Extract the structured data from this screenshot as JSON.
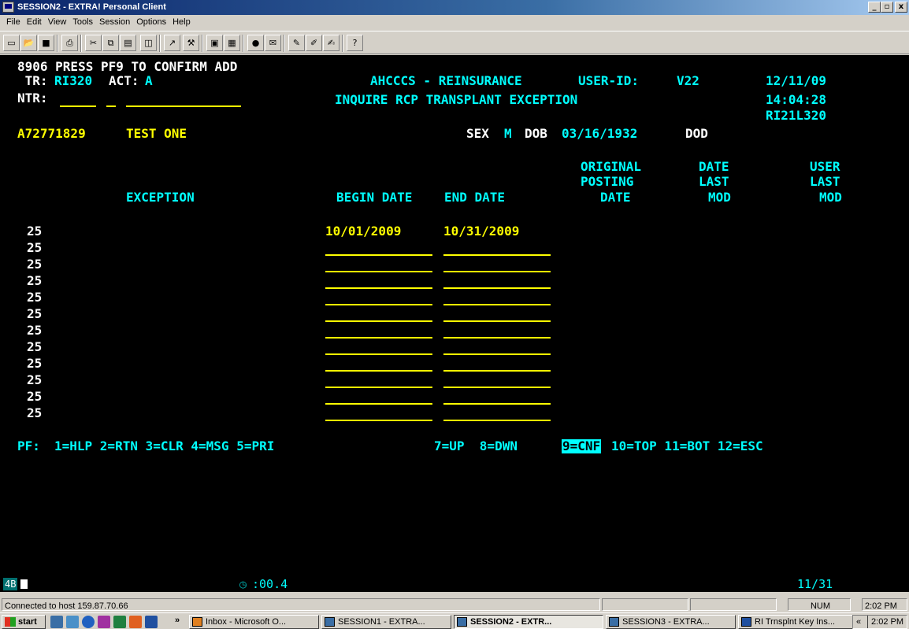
{
  "window": {
    "title": "SESSION2 - EXTRA! Personal Client",
    "min": "_",
    "max": "▫",
    "close": "x"
  },
  "menu": [
    "File",
    "Edit",
    "View",
    "Tools",
    "Session",
    "Options",
    "Help"
  ],
  "toolbar_icons": [
    "new-icon",
    "open-icon",
    "save-icon",
    "print-icon",
    "cut-icon",
    "copy-icon",
    "paste-icon",
    "macro-icon",
    "open-macro-icon",
    "tools-icon",
    "session-icon",
    "transfer-icon",
    "record-icon",
    "send-icon",
    "edit-icon",
    "edit2-icon",
    "edit3-icon",
    "help-icon"
  ],
  "terminal": {
    "msg": "8906 PRESS PF9 TO CONFIRM ADD",
    "tr_label": " TR:",
    "tr_value": "RI320",
    "act_label": "ACT:",
    "act_value": "A",
    "ntr_label": "NTR:",
    "system": "AHCCCS - REINSURANCE",
    "user_label": "USER-ID:",
    "user_value": "V22",
    "date": "12/11/09",
    "screen_title": "INQUIRE RCP TRANSPLANT EXCEPTION",
    "time": "14:04:28",
    "screen_id": "RI21L320",
    "member_id": "A72771829",
    "member_name": "TEST ONE",
    "sex_label": "SEX",
    "sex_value": "M",
    "dob_label": "DOB",
    "dob_value": "03/16/1932",
    "dod_label": "DOD",
    "col_exception": "EXCEPTION",
    "col_begin": "BEGIN DATE",
    "col_end": "END DATE",
    "col_orig_1": "ORIGINAL",
    "col_orig_2": "POSTING",
    "col_orig_3": "DATE",
    "col_dlm_1": "DATE",
    "col_dlm_2": "LAST",
    "col_dlm_3": "MOD",
    "col_ulm_1": "USER",
    "col_ulm_2": "LAST",
    "col_ulm_3": "MOD",
    "rows": [
      {
        "exception": "25",
        "begin": "10/01/2009",
        "end": "10/31/2009"
      },
      {
        "exception": "25",
        "begin": "",
        "end": ""
      },
      {
        "exception": "25",
        "begin": "",
        "end": ""
      },
      {
        "exception": "25",
        "begin": "",
        "end": ""
      },
      {
        "exception": "25",
        "begin": "",
        "end": ""
      },
      {
        "exception": "25",
        "begin": "",
        "end": ""
      },
      {
        "exception": "25",
        "begin": "",
        "end": ""
      },
      {
        "exception": "25",
        "begin": "",
        "end": ""
      },
      {
        "exception": "25",
        "begin": "",
        "end": ""
      },
      {
        "exception": "25",
        "begin": "",
        "end": ""
      },
      {
        "exception": "25",
        "begin": "",
        "end": ""
      },
      {
        "exception": "25",
        "begin": "",
        "end": ""
      }
    ],
    "pf_label": "PF:",
    "pf_keys_a": "1=HLP 2=RTN 3=CLR 4=MSG 5=PRI",
    "pf_keys_b": "7=UP  8=DWN",
    "pf_key_hl": "9=CNF",
    "pf_keys_c": "10=TOP 11=BOT 12=ESC"
  },
  "oia": {
    "mode": "4B",
    "timer": ":00.4",
    "cursor": "11/31"
  },
  "status": {
    "connection": "Connected to host 159.87.70.66",
    "num": "NUM",
    "time": "2:02 PM"
  },
  "taskbar": {
    "start": "start",
    "overflow": "»",
    "tasks": [
      "Inbox - Microsoft O...",
      "SESSION1 - EXTRA...",
      "SESSION2 - EXTR...",
      "SESSION3 - EXTRA...",
      "RI Trnsplnt Key Ins..."
    ],
    "tray_arrow": "«",
    "tray_time": "2:02 PM"
  }
}
